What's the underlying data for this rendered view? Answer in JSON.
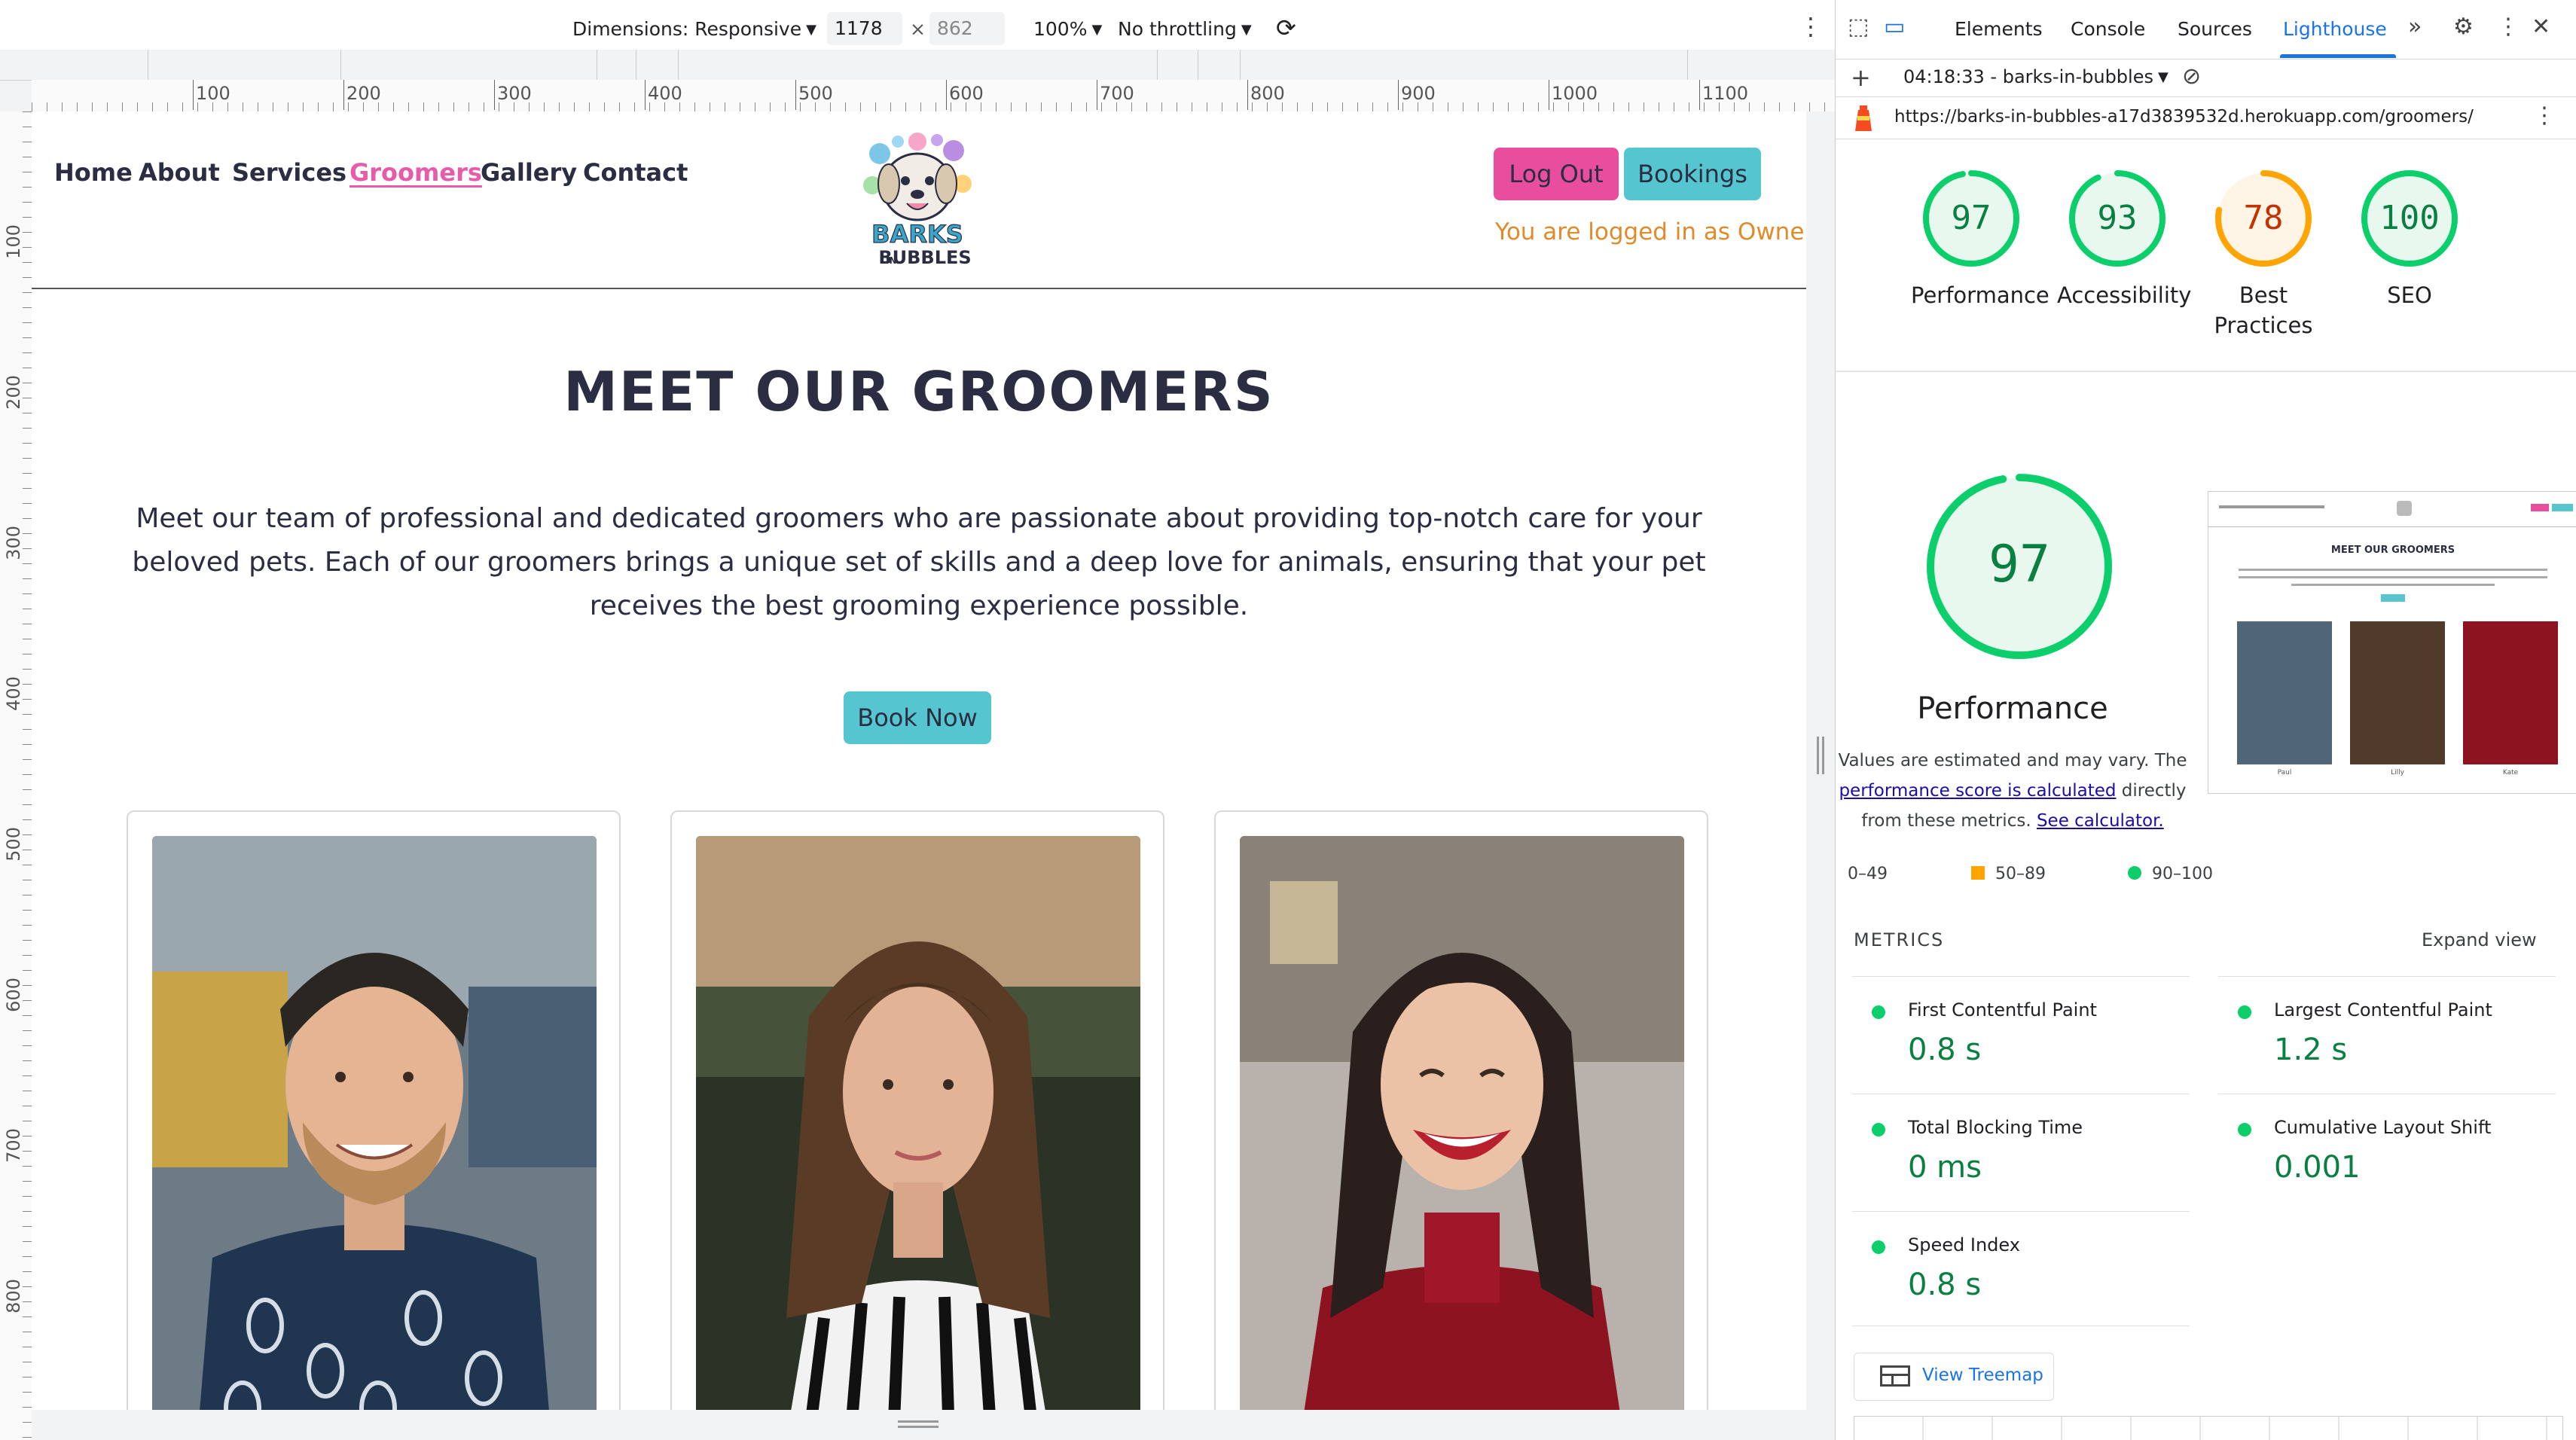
{
  "device_toolbar": {
    "dimensions_label": "Dimensions: Responsive",
    "width": "1178",
    "times": "×",
    "height": "862",
    "zoom": "100%",
    "throttling": "No throttling"
  },
  "rulers": {
    "top": [
      "100",
      "200",
      "300",
      "400",
      "500",
      "600",
      "700",
      "800",
      "900",
      "1000",
      "1100"
    ],
    "left": [
      "100",
      "200",
      "300",
      "400",
      "500",
      "600",
      "700",
      "800"
    ]
  },
  "site": {
    "nav": [
      "Home",
      "About",
      "Services",
      "Groomers",
      "Gallery",
      "Contact"
    ],
    "active_nav": "Groomers",
    "logo_top": "BARKS",
    "logo_small": "IN",
    "logo_bottom": "BUBBLES",
    "logout_label": "Log Out",
    "bookings_label": "Bookings",
    "logged_in_text": "You are logged in as Owner",
    "title": "MEET OUR GROOMERS",
    "intro": "Meet our team of professional and dedicated groomers who are passionate about providing top-notch care for your beloved pets. Each of our groomers brings a unique set of skills and a deep love for animals, ensuring that your pet receives the best grooming experience possible.",
    "book_now_label": "Book Now"
  },
  "devtools": {
    "tabs": [
      "Elements",
      "Console",
      "Sources",
      "Lighthouse"
    ],
    "active_tab": "Lighthouse",
    "more_tabs": "»",
    "report_label": "04:18:33 - barks-in-bubbles",
    "url": "https://barks-in-bubbles-a17d3839532d.herokuapp.com/groomers/",
    "scores": [
      {
        "label": "Performance",
        "score": 97,
        "color": "#0cce6b"
      },
      {
        "label": "Accessibility",
        "score": 93,
        "color": "#0cce6b"
      },
      {
        "label": "Best Practices",
        "score": 78,
        "color": "#ffa400"
      },
      {
        "label": "SEO",
        "score": 100,
        "color": "#0cce6b"
      }
    ],
    "performance": {
      "score": 97,
      "heading": "Performance",
      "note_before": "Values are estimated and may vary. The ",
      "note_link": "performance score is calculated",
      "note_mid": " directly from these metrics. ",
      "note_link2": "See calculator."
    },
    "legend": [
      "0–49",
      "50–89",
      "90–100"
    ],
    "metrics_title": "METRICS",
    "expand_view": "Expand view",
    "metrics": [
      {
        "label": "First Contentful Paint",
        "value": "0.8 s"
      },
      {
        "label": "Largest Contentful Paint",
        "value": "1.2 s"
      },
      {
        "label": "Total Blocking Time",
        "value": "0 ms"
      },
      {
        "label": "Cumulative Layout Shift",
        "value": "0.001"
      },
      {
        "label": "Speed Index",
        "value": "0.8 s"
      }
    ],
    "treemap_label": "View Treemap",
    "thumbnail": {
      "title": "MEET OUR GROOMERS",
      "names": [
        "Paul",
        "Lilly",
        "Kate"
      ]
    }
  }
}
